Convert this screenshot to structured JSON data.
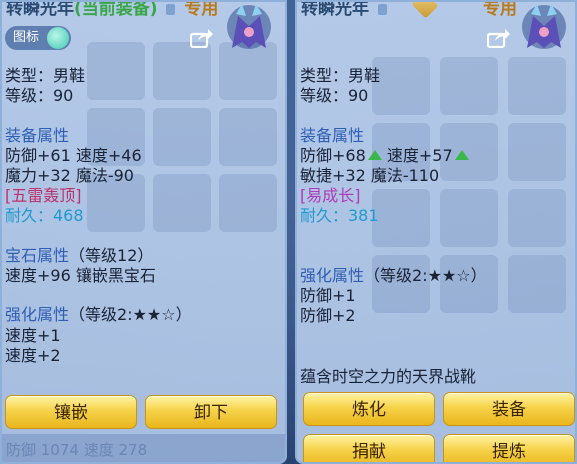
{
  "left_panel": {
    "title": {
      "name": "转瞬光年",
      "equipped_note": "(当前装备)",
      "exclusive": "专用"
    },
    "icon_toggle_label": "图标",
    "type_line": "类型：男鞋",
    "level_line": "等级：90",
    "attr_header": "装备属性",
    "attr_line1": "防御+61 速度+46",
    "attr_line2": "魔力+32 魔法-90",
    "special": "[五雷轰顶]",
    "durability": "耐久：468",
    "gem_header": "宝石属性",
    "gem_level": "（等级12）",
    "gem_line": "速度+96 镶嵌黑宝石",
    "enhance_header": "强化属性",
    "enhance_level": "（等级2:★★☆）",
    "enhance_line1": "速度+1",
    "enhance_line2": "速度+2",
    "btn_inlay": "镶嵌",
    "btn_unequip": "卸下",
    "bottom_text": "防御    1074    速度    278"
  },
  "right_panel": {
    "title": {
      "name": "转瞬光年",
      "exclusive": "专用"
    },
    "type_line": "类型：男鞋",
    "level_line": "等级：90",
    "attr_header": "装备属性",
    "attr_line1a": "防御+68",
    "attr_line1b": "速度+57",
    "attr_line2": "敏捷+32 魔法-110",
    "special": "[易成长]",
    "durability": "耐久：381",
    "enhance_header": "强化属性",
    "enhance_level": "（等级2:★★☆）",
    "enhance_line1": "防御+1",
    "enhance_line2": "防御+2",
    "set_name": "蕴含时空之力的天界战靴",
    "btn_refine": "炼化",
    "btn_equip": "装备",
    "btn_donate": "捐献",
    "btn_extract": "提炼"
  },
  "colors": {
    "panel_bg": "#b9cceb",
    "section_blue": "#2f5fb4",
    "special_red": "#c0306a",
    "special_purple": "#b03ab8",
    "durability_cyan": "#1f9bd0",
    "button_gold": "#f6d34a",
    "up_arrow_green": "#39b84a"
  },
  "icons": [
    "lock-icon",
    "share-icon",
    "character-avatar",
    "toggle-knob",
    "diamond-badge-icon",
    "up-arrow-icon"
  ]
}
